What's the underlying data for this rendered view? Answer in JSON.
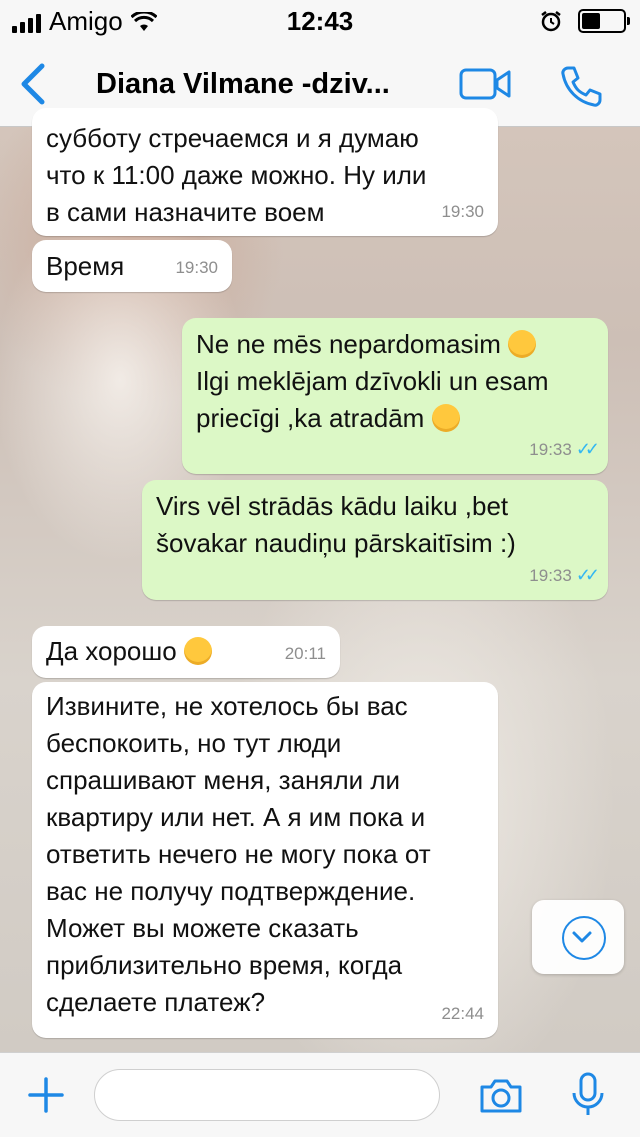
{
  "status_bar": {
    "carrier": "Amigo",
    "time": "12:43"
  },
  "header": {
    "title": "Diana Vilmane -dziv..."
  },
  "messages": [
    {
      "direction": "in",
      "lines": [
        "субботу стречаемся и я думаю",
        "что к 11:00 даже можно. Ну или",
        "в сами назначите воем"
      ],
      "time": "19:30"
    },
    {
      "direction": "in",
      "lines": [
        "Время"
      ],
      "time": "19:30"
    },
    {
      "direction": "out",
      "lines": [
        "Ne ne mēs nepardomasim",
        "Ilgi meklējam dzīvokli un esam",
        "priecīgi ,ka atradām"
      ],
      "time": "19:33"
    },
    {
      "direction": "out",
      "lines": [
        "Virs vēl strādās kādu laiku ,bet",
        "šovakar naudiņu pārskaitīsim :)"
      ],
      "time": "19:33"
    },
    {
      "direction": "in",
      "lines": [
        "Да хорошо"
      ],
      "time": "20:11"
    },
    {
      "direction": "in",
      "lines": [
        "Извините, не хотелось бы вас",
        "беспокоить, но тут люди",
        "спрашивают меня, заняли ли",
        "квартиру или нет. А я им пока и",
        "ответить нечего не могу пока от",
        "вас не получу подтверждение.",
        "Может вы можете сказать",
        "приблизительно время, когда",
        "сделаете платеж?"
      ],
      "time": "22:44"
    }
  ],
  "colors": {
    "accent": "#1e88e5",
    "incoming_bubble": "#ffffff",
    "outgoing_bubble": "#dcf8c6",
    "read_ticks": "#34b7f1"
  },
  "icons": {
    "back": "chevron-left-icon",
    "video": "video-camera-icon",
    "call": "phone-icon",
    "attach": "plus-icon",
    "camera": "camera-icon",
    "mic": "microphone-icon",
    "scroll": "chevron-down-icon"
  }
}
